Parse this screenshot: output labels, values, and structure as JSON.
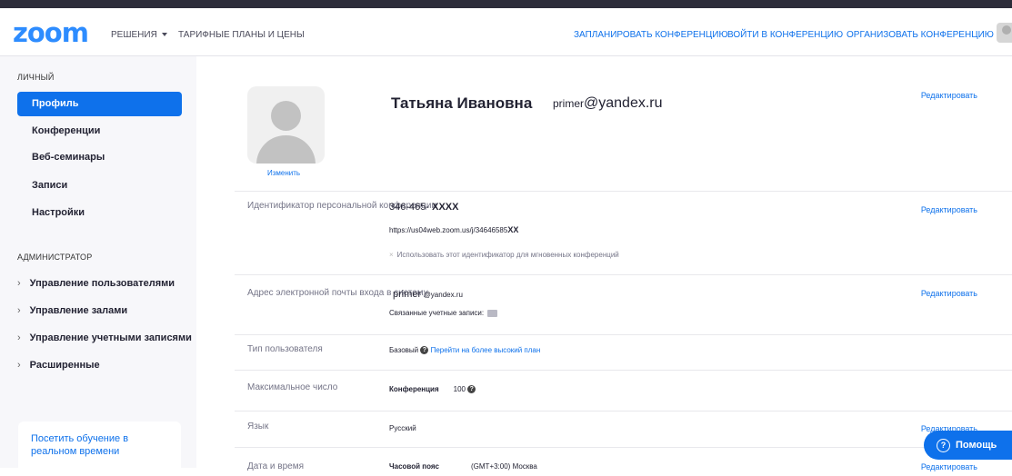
{
  "header": {
    "logo": "zoom",
    "nav_left": [
      "РЕШЕНИЯ",
      "ТАРИФНЫЕ ПЛАНЫ И ЦЕНЫ"
    ],
    "nav_right": [
      "ЗАПЛАНИРОВАТЬ КОНФЕРЕНЦИЮ",
      "ВОЙТИ В КОНФЕРЕНЦИЮ",
      "ОРГАНИЗОВАТЬ КОНФЕРЕНЦИЮ"
    ]
  },
  "sidebar": {
    "personal_title": "ЛИЧНЫЙ",
    "personal_items": [
      "Профиль",
      "Конференции",
      "Веб-семинары",
      "Записи",
      "Настройки"
    ],
    "admin_title": "АДМИНИСТРАТОР",
    "admin_items": [
      "Управление пользователями",
      "Управление залами",
      "Управление учетными записями",
      "Расширенные"
    ],
    "promo": "Посетить обучение в реальном времени"
  },
  "profile": {
    "change_photo": "Изменить",
    "name": "Татьяна Ивановна",
    "email_prefix": "primer",
    "email_domain": "@yandex.ru",
    "edit": "Редактировать"
  },
  "rows": {
    "pmi_label": "Идентификатор персональной конференции",
    "pmi_number": "346-465-",
    "pmi_mask": "XXXX",
    "pmi_url": "https://us04web.zoom.us/j/34646585",
    "pmi_url_mask": "XX",
    "pmi_option": "Использовать этот идентификатор для мгновенных конференций",
    "login_label": "Адрес электронной почты входа в систему",
    "login_prefix": "primer",
    "login_domain": "@yandex.ru",
    "linked_accounts": "Связанные учетные записи:",
    "usertype_label": "Тип пользователя",
    "usertype_value": "Базовый",
    "upgrade_link": "Перейти на более высокий план",
    "capacity_label": "Максимальное число",
    "capacity_type": "Конференция",
    "capacity_value": "100",
    "lang_label": "Язык",
    "lang_value": "Русский",
    "datetime_label": "Дата и время",
    "timezone_label": "Часовой пояс",
    "timezone_value": "(GMT+3:00) Москва"
  },
  "help_button": "Помощь",
  "colors": {
    "accent": "#0e71eb",
    "logo": "#2d8cff",
    "sidebar_bg": "#f7f7fa"
  }
}
